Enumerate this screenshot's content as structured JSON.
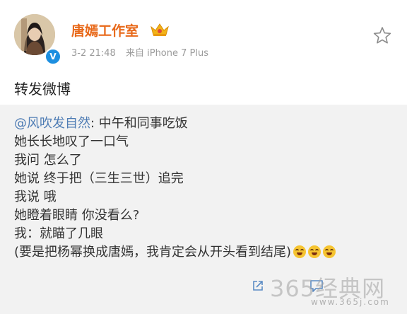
{
  "post": {
    "author": "唐嫣工作室",
    "date": "3-2 21:48",
    "source": "来自 iPhone 7 Plus",
    "body": "转发微博"
  },
  "quoted": {
    "mention": "@风吹发自然",
    "first_line_rest": ": 中午和同事吃饭",
    "lines": [
      "她长长地叹了一口气",
      "我问 怎么了",
      "她说 终于把（三生三世）追完",
      "我说 哦",
      "她瞪着眼睛 你没看么?",
      "我：就瞄了几眼",
      "(要是把杨幂换成唐嫣，我肯定会从开头看到结尾)"
    ]
  },
  "watermark": {
    "main": "365经典网",
    "url": "www.365j.com"
  },
  "colors": {
    "username": "#e8691a",
    "mention": "#4e7cb4",
    "verified_badge": "#1d8fe0"
  },
  "icons": [
    "crown-icon",
    "verified-icon",
    "star-icon",
    "share-icon",
    "comment-icon",
    "laughing-emoji"
  ]
}
